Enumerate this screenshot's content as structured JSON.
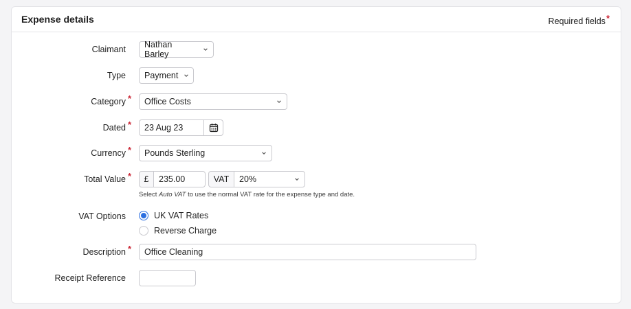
{
  "card": {
    "title": "Expense details",
    "required_note": "Required fields",
    "required_mark": "*"
  },
  "form": {
    "claimant": {
      "label": "Claimant",
      "value": "Nathan Barley",
      "required": false
    },
    "type": {
      "label": "Type",
      "value": "Payment",
      "required": false
    },
    "category": {
      "label": "Category",
      "value": "Office Costs",
      "required": true
    },
    "dated": {
      "label": "Dated",
      "value": "23 Aug 23",
      "required": true
    },
    "currency": {
      "label": "Currency",
      "value": "Pounds Sterling",
      "required": true
    },
    "total_value": {
      "label": "Total Value",
      "required": true,
      "currency_symbol": "£",
      "value": "235.00",
      "vat_label": "VAT",
      "vat_rate": "20%",
      "hint_prefix": "Select ",
      "hint_em": "Auto VAT",
      "hint_suffix": " to use the normal VAT rate for the expense type and date."
    },
    "vat_options": {
      "label": "VAT Options",
      "options": [
        {
          "label": "UK VAT Rates",
          "selected": true
        },
        {
          "label": "Reverse Charge",
          "selected": false
        }
      ]
    },
    "description": {
      "label": "Description",
      "value": "Office Cleaning",
      "required": true
    },
    "receipt_reference": {
      "label": "Receipt Reference",
      "value": "",
      "required": false
    }
  },
  "colors": {
    "required": "#cc2b3a",
    "accent": "#2d6fe0"
  },
  "icons": {
    "dropdown": "chevron-down-icon",
    "date": "calendar-icon"
  }
}
